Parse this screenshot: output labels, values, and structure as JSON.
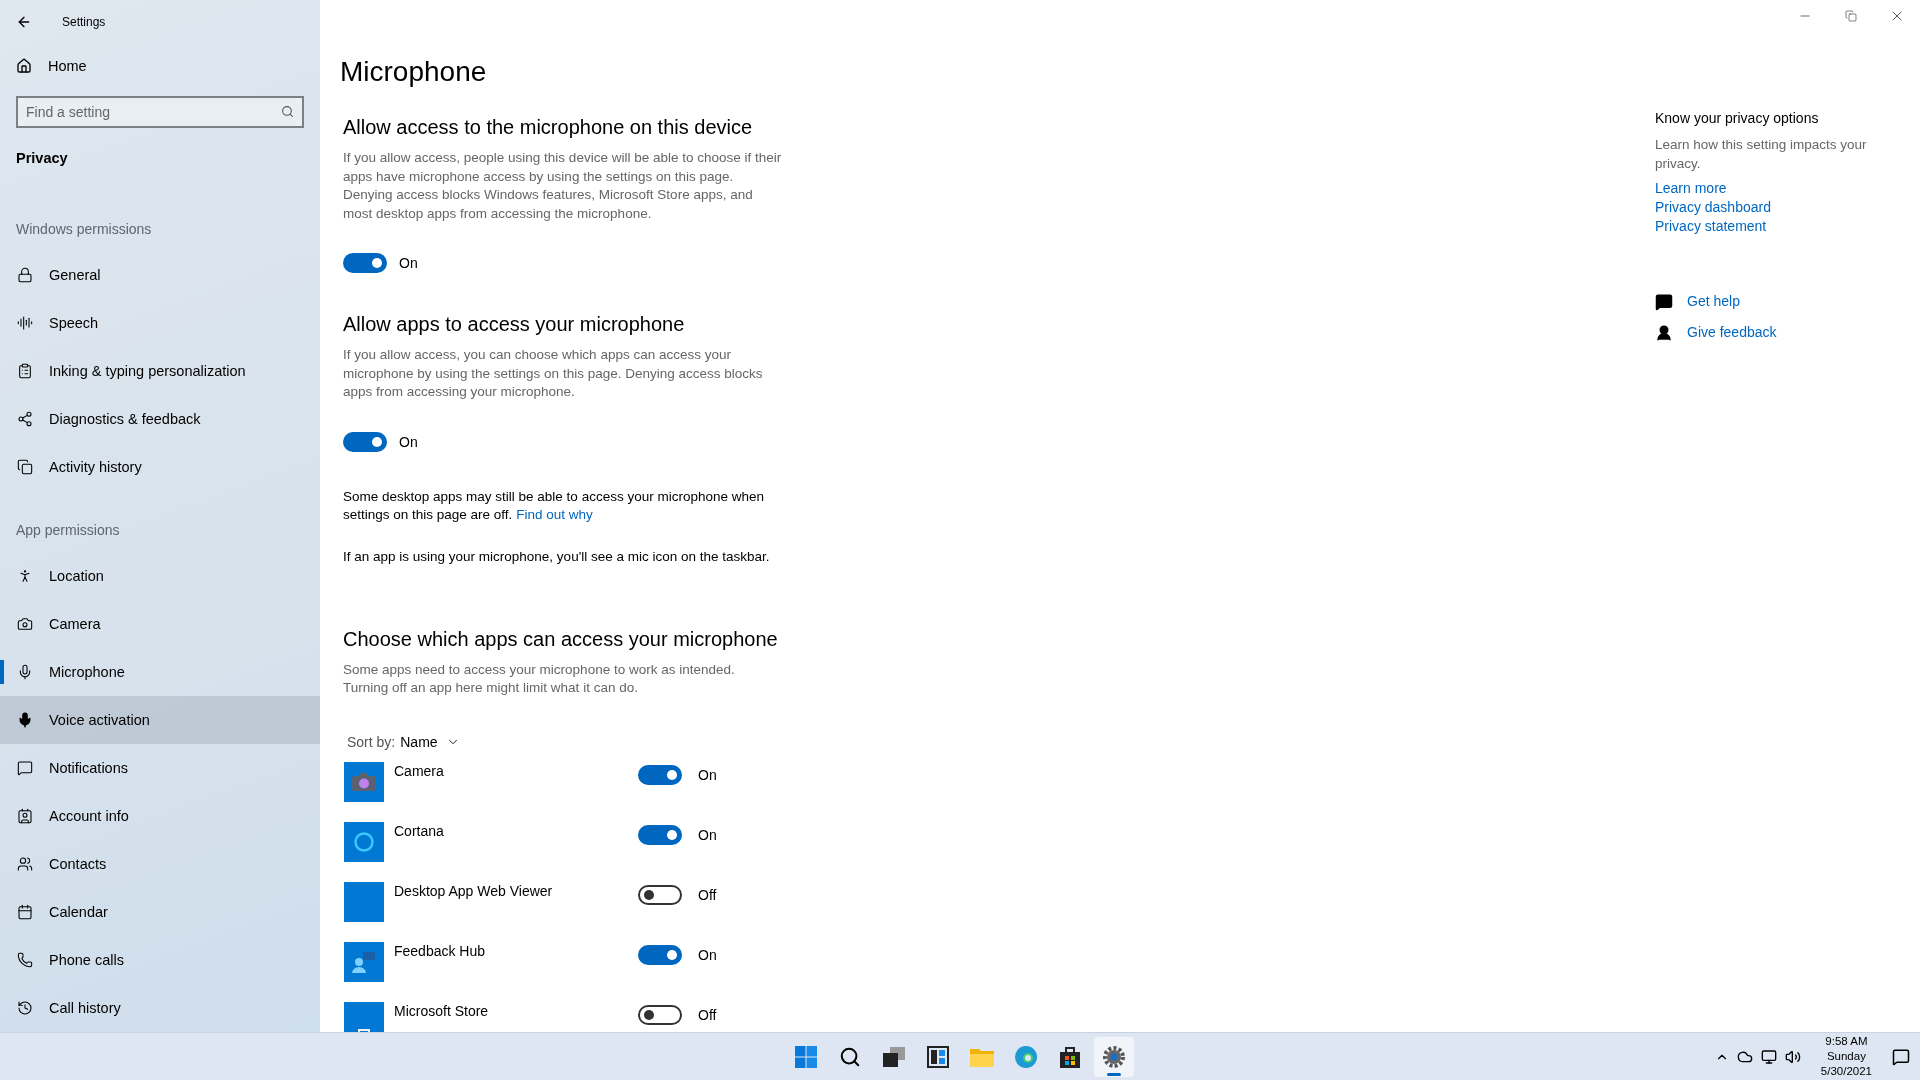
{
  "window": {
    "title": "Settings"
  },
  "sidebar": {
    "home": "Home",
    "search": {
      "placeholder": "Find a setting"
    },
    "category": "Privacy",
    "groups": [
      {
        "heading": "Windows permissions",
        "items": [
          {
            "label": "General",
            "selected": false,
            "hovered": false
          },
          {
            "label": "Speech",
            "selected": false,
            "hovered": false
          },
          {
            "label": "Inking & typing personalization",
            "selected": false,
            "hovered": false
          },
          {
            "label": "Diagnostics & feedback",
            "selected": false,
            "hovered": false
          },
          {
            "label": "Activity history",
            "selected": false,
            "hovered": false
          }
        ]
      },
      {
        "heading": "App permissions",
        "items": [
          {
            "label": "Location",
            "selected": false,
            "hovered": false
          },
          {
            "label": "Camera",
            "selected": false,
            "hovered": false
          },
          {
            "label": "Microphone",
            "selected": true,
            "hovered": false
          },
          {
            "label": "Voice activation",
            "selected": false,
            "hovered": true
          },
          {
            "label": "Notifications",
            "selected": false,
            "hovered": false
          },
          {
            "label": "Account info",
            "selected": false,
            "hovered": false
          },
          {
            "label": "Contacts",
            "selected": false,
            "hovered": false
          },
          {
            "label": "Calendar",
            "selected": false,
            "hovered": false
          },
          {
            "label": "Phone calls",
            "selected": false,
            "hovered": false
          },
          {
            "label": "Call history",
            "selected": false,
            "hovered": false
          }
        ]
      }
    ]
  },
  "main": {
    "title": "Microphone",
    "sections": [
      {
        "heading": "Allow access to the microphone on this device",
        "description": "If you allow access, people using this device will be able to choose if their apps have microphone access by using the settings on this page. Denying access blocks Windows features, Microsoft Store apps, and most desktop apps from accessing the microphone.",
        "toggle": {
          "on": true,
          "label": "On"
        }
      },
      {
        "heading": "Allow apps to access your microphone",
        "description": "If you allow access, you can choose which apps can access your microphone by using the settings on this page. Denying access blocks apps from accessing your microphone.",
        "toggle": {
          "on": true,
          "label": "On"
        }
      }
    ],
    "note": {
      "text": "Some desktop apps may still be able to access your microphone when settings on this page are off.",
      "link": "Find out why"
    },
    "mic_note": "If an app is using your microphone, you'll see a mic icon on the taskbar.",
    "apps_section": {
      "heading": "Choose which apps can access your microphone",
      "description": "Some apps need to access your microphone to work as intended. Turning off an app here might limit what it can do.",
      "sort": {
        "label": "Sort by:",
        "value": "Name"
      },
      "apps": [
        {
          "name": "Camera",
          "on": true,
          "label": "On"
        },
        {
          "name": "Cortana",
          "on": true,
          "label": "On"
        },
        {
          "name": "Desktop App Web Viewer",
          "on": false,
          "label": "Off"
        },
        {
          "name": "Feedback Hub",
          "on": true,
          "label": "On"
        },
        {
          "name": "Microsoft Store",
          "on": false,
          "label": "Off"
        }
      ]
    }
  },
  "aside": {
    "heading": "Know your privacy options",
    "text": "Learn how this setting impacts your privacy.",
    "links": [
      "Learn more",
      "Privacy dashboard",
      "Privacy statement"
    ],
    "help": [
      "Get help",
      "Give feedback"
    ]
  },
  "taskbar": {
    "apps": [
      {
        "selected": false
      },
      {
        "selected": false
      },
      {
        "selected": false
      },
      {
        "selected": false
      },
      {
        "selected": false
      },
      {
        "selected": false
      },
      {
        "selected": false
      },
      {
        "selected": true
      }
    ],
    "clock": {
      "time": "9:58 AM",
      "day": "Sunday",
      "date": "5/30/2021"
    }
  }
}
